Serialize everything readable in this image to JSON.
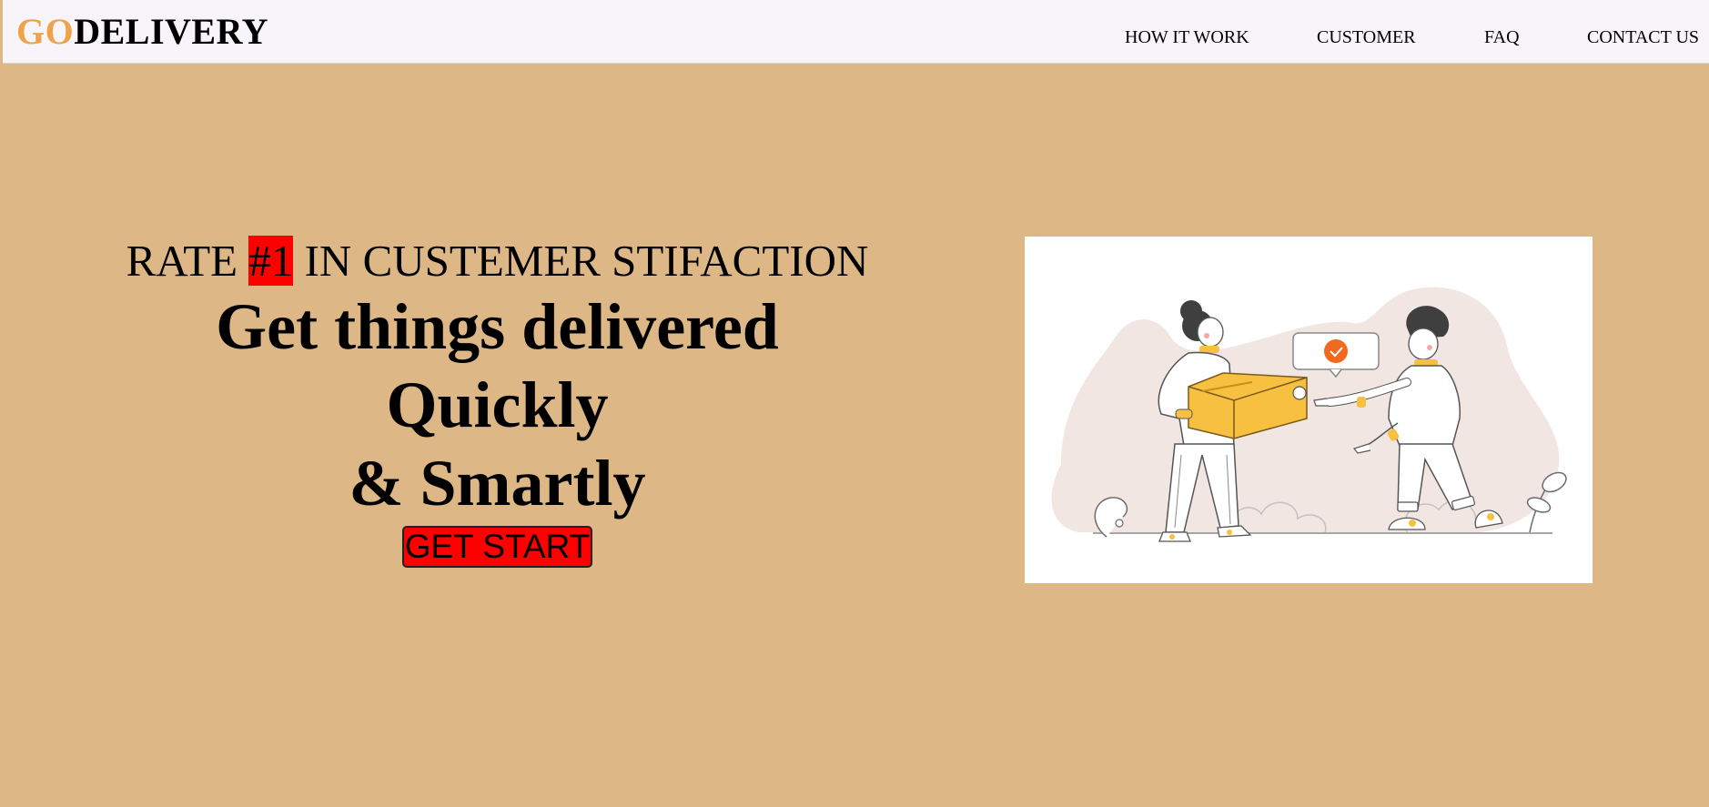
{
  "header": {
    "logo_go": "GO",
    "logo_rest": "DELIVERY",
    "nav": [
      "HOW IT WORK",
      "CUSTOMER",
      "FAQ",
      "CONTACT US"
    ]
  },
  "hero": {
    "tagline_before": "RATE ",
    "tagline_rank": "#1",
    "tagline_after": " IN CUSTEMER STIFACTION",
    "headline_lines": [
      "Get things delivered",
      "Quickly",
      "& Smartly"
    ],
    "cta_label": "GET START"
  },
  "illustration": {
    "description_icon": "delivery-handoff-illustration"
  },
  "colors": {
    "background": "#ddb886",
    "navbar": "#f7f5fa",
    "accent_logo": "#f0a24a",
    "highlight": "#ff0000",
    "box_yellow": "#f7c040"
  }
}
